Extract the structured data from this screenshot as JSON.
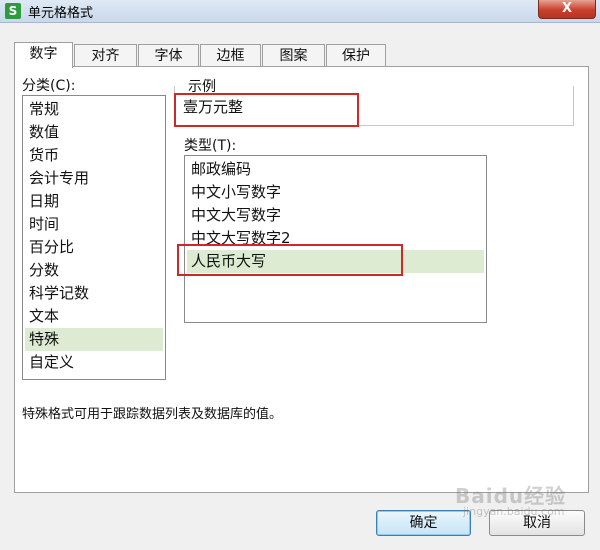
{
  "window": {
    "title": "单元格格式",
    "icon_letter": "S",
    "close_label": "X"
  },
  "tabs": [
    {
      "label": "数字",
      "active": true
    },
    {
      "label": "对齐",
      "active": false
    },
    {
      "label": "字体",
      "active": false
    },
    {
      "label": "边框",
      "active": false
    },
    {
      "label": "图案",
      "active": false
    },
    {
      "label": "保护",
      "active": false
    }
  ],
  "category": {
    "label": "分类(C):",
    "items": [
      "常规",
      "数值",
      "货币",
      "会计专用",
      "日期",
      "时间",
      "百分比",
      "分数",
      "科学记数",
      "文本",
      "特殊",
      "自定义"
    ],
    "selected": "特殊"
  },
  "sample": {
    "label": "示例",
    "value": "壹万元整"
  },
  "type": {
    "label": "类型(T):",
    "items": [
      "邮政编码",
      "中文小写数字",
      "中文大写数字",
      "中文大写数字2",
      "人民币大写"
    ],
    "selected": "人民币大写"
  },
  "description": "特殊格式可用于跟踪数据列表及数据库的值。",
  "buttons": {
    "ok": "确定",
    "cancel": "取消"
  },
  "watermark": {
    "text": "Baidu经验",
    "sub": "jingyan.baidu.com"
  },
  "colors": {
    "highlight": "#dcebd1",
    "annotation": "#cc2a2a",
    "close": "#c8402d"
  }
}
